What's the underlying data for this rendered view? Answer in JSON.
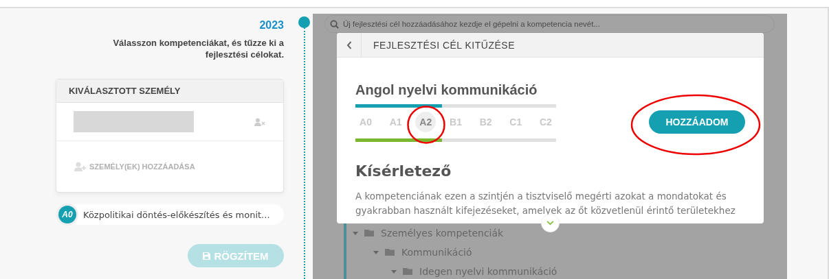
{
  "year": "2023",
  "intro": "Válasszon kompetenciákat, és tűzze ki a fejlesztési célokat.",
  "selected_person_card": {
    "title": "KIVÁLASZTOTT SZEMÉLY",
    "add_persons": "SZEMÉLY(EK) HOZZÁADÁSA"
  },
  "competency_chip": {
    "level_badge": "A0",
    "name": "Közpolitikai döntés-előkészítés és monit..."
  },
  "save_button": {
    "label": "RÖGZÍTEM",
    "disabled": true
  },
  "search": {
    "placeholder": "Új fejlesztési cél hozzáadásához kezdje el gépelni a kompetencia nevét..."
  },
  "tree": [
    {
      "label": "Személyes kompetenciák",
      "expanded": true,
      "children": [
        {
          "label": "Kommunikáció",
          "expanded": true,
          "children": [
            {
              "label": "Idegen nyelvi kommunikáció",
              "expanded": true
            }
          ]
        }
      ]
    }
  ],
  "modal": {
    "title": "FEJLESZTÉSI CÉL KITŰZÉSE",
    "competency": "Angol nyelvi kommunikáció",
    "target_bar": {
      "level": 0.43
    },
    "current_bar": {
      "level": 0.43
    },
    "levels": [
      {
        "label": "A0",
        "selected": false
      },
      {
        "label": "A1",
        "selected": false
      },
      {
        "label": "A2",
        "selected": true
      },
      {
        "label": "B1",
        "selected": false
      },
      {
        "label": "B2",
        "selected": false
      },
      {
        "label": "C1",
        "selected": false
      },
      {
        "label": "C2",
        "selected": false
      }
    ],
    "add_button": "HOZZÁADOM",
    "level_name": "Kísérletező",
    "description": "A kompetenciának ezen a szintjén a tisztviselő megérti azokat a mondatokat és gyakrabban használt kifejezéseket, amelyek az őt közvetlenül érintő területekhez"
  }
}
